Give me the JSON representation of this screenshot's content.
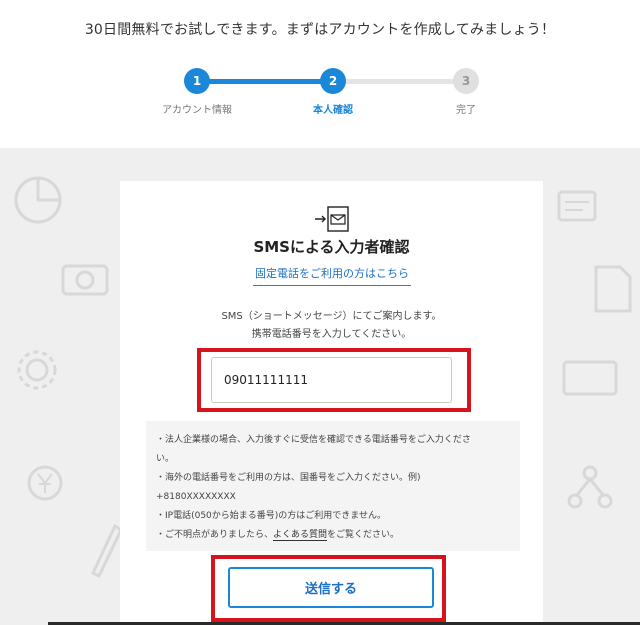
{
  "intro": "30日間無料でお試しできます。まずはアカウントを作成してみましょう！",
  "steps": [
    {
      "num": "1",
      "label": "アカウント情報"
    },
    {
      "num": "2",
      "label": "本人確認"
    },
    {
      "num": "3",
      "label": "完了"
    }
  ],
  "card": {
    "title": "SMSによる入力者確認",
    "landline_link": "固定電話をご利用の方はこちら",
    "guide_line1": "SMS（ショートメッセージ）にてご案内します。",
    "guide_line2": "携帯電話番号を入力してください。",
    "phone_value": "09011111111",
    "notes": {
      "line1": "・法人企業様の場合、入力後すぐに受信を確認できる電話番号をご入力くださ",
      "line2": "い。",
      "line3": "・海外の電話番号をご利用の方は、国番号をご入力ください。例)",
      "line4": "+8180XXXXXXXX",
      "line5": "・IP電話(050から始まる番号)の方はご利用できません。",
      "line6_prefix": "・ご不明点がありましたら、",
      "line6_link": "よくある質問",
      "line6_suffix": "をご覧ください。"
    },
    "submit_label": "送信する"
  },
  "colors": {
    "accent": "#1b87d8",
    "highlight": "#d7141e",
    "background": "#efefef"
  }
}
